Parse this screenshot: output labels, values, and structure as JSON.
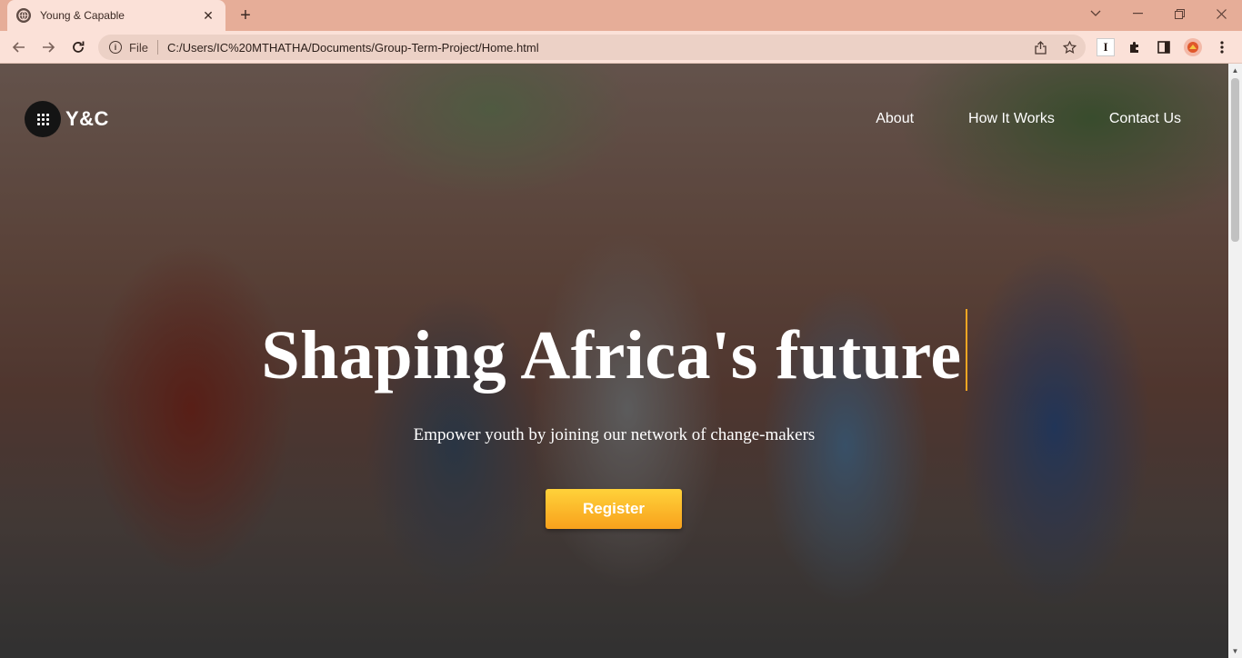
{
  "browser": {
    "tab_title": "Young & Capable",
    "tab_close": "✕",
    "new_tab": "+",
    "file_label": "File",
    "url": "C:/Users/IC%20MTHATHA/Documents/Group-Term-Project/Home.html",
    "extension_letter": "I"
  },
  "page": {
    "logo_text": "Y&C",
    "nav": [
      "About",
      "How It Works",
      "Contact Us"
    ],
    "headline": "Shaping Africa's future",
    "subline": "Empower youth by joining our network of change-makers",
    "register_label": "Register"
  },
  "colors": {
    "accent": "#f5a623",
    "tabbar": "#e6ad98",
    "toolbar": "#fbe1d8"
  }
}
